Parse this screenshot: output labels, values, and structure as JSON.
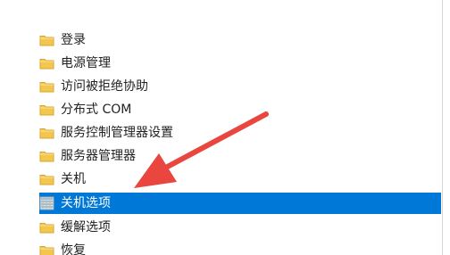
{
  "tree": {
    "items": [
      {
        "label": "登录"
      },
      {
        "label": "电源管理"
      },
      {
        "label": "访问被拒绝协助"
      },
      {
        "label": "分布式 COM"
      },
      {
        "label": "服务控制管理器设置"
      },
      {
        "label": "服务器管理器"
      },
      {
        "label": "关机"
      },
      {
        "label": "关机选项"
      },
      {
        "label": "缓解选项"
      },
      {
        "label": "恢复"
      }
    ],
    "selected_index": 7
  },
  "colors": {
    "selection": "#0078d7",
    "folder": "#f3c74f",
    "annotation_arrow": "#e8463f"
  },
  "icons": {
    "folder": "folder-icon",
    "policy": "policy-settings-icon"
  }
}
